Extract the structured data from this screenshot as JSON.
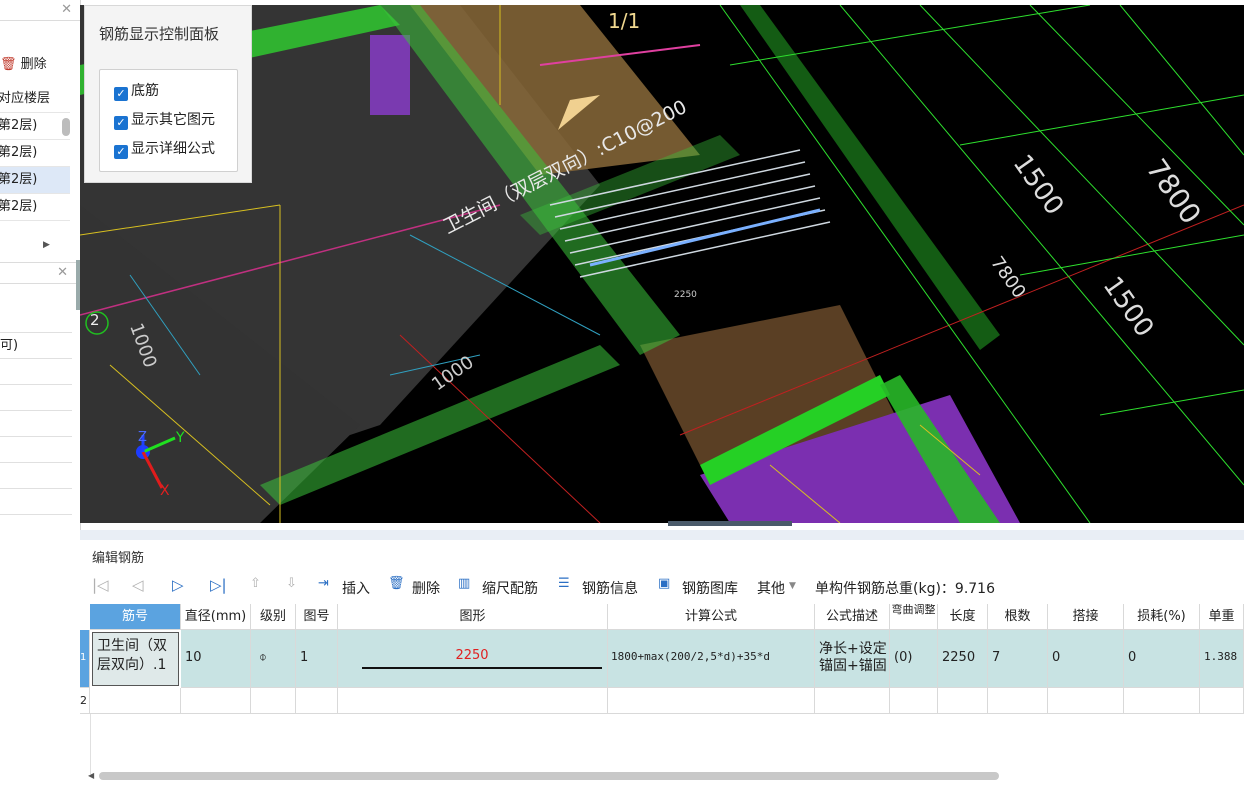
{
  "left_panel": {
    "delete_label": "删除",
    "header_col": "对应楼层",
    "floors": [
      "第2层)",
      "第2层)",
      "第2层)",
      "第2层)"
    ],
    "prop_value": "可)"
  },
  "viewport": {
    "page_indicator": "1/1",
    "dims": [
      "1500",
      "7800",
      "7800",
      "1500",
      "1000",
      "1000",
      "2250"
    ],
    "slab_label": "卫生间（双层双向）:C10@200",
    "axis_number": "2",
    "gizmo": {
      "z": "Z",
      "y": "Y",
      "x": "X"
    }
  },
  "control_panel": {
    "title": "钢筋显示控制面板",
    "checkboxes": [
      {
        "label": "底筋",
        "checked": true
      },
      {
        "label": "显示其它图元",
        "checked": true
      },
      {
        "label": "显示详细公式",
        "checked": true
      }
    ]
  },
  "editor": {
    "title": "编辑钢筋",
    "toolbar": {
      "insert": "插入",
      "delete": "删除",
      "scale_rebar": "缩尺配筋",
      "rebar_info": "钢筋信息",
      "rebar_lib": "钢筋图库",
      "other": "其他",
      "total_weight": "单构件钢筋总重(kg)：9.716"
    },
    "columns": [
      "筋号",
      "直径(mm)",
      "级别",
      "图号",
      "图形",
      "计算公式",
      "公式描述",
      "弯曲调整",
      "长度",
      "根数",
      "搭接",
      "损耗(%)",
      "单重"
    ],
    "rows": [
      {
        "index": "1",
        "name": "卫生间（双层双向）.1",
        "diameter": "10",
        "grade": "⌽",
        "figure_no": "1",
        "shape_value": "2250",
        "formula": "1800+max(200/2,5*d)+35*d",
        "desc": "净长+设定锚固+锚固",
        "bend": "(0)",
        "length": "2250",
        "count": "7",
        "lap": "0",
        "loss": "0",
        "unit_weight": "1.388"
      }
    ],
    "empty_row_index": "2"
  }
}
